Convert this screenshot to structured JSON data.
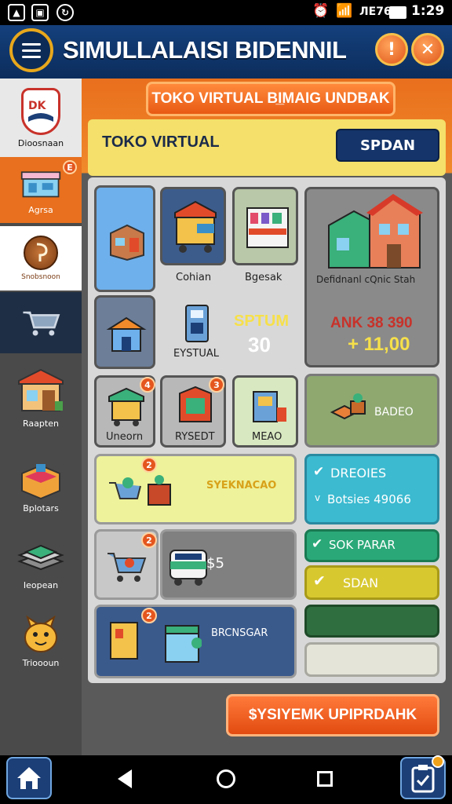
{
  "status_bar": {
    "battery": "ЛЕ76",
    "time": "1:29"
  },
  "header": {
    "title": "SIMULLALAISI BIDENNIL"
  },
  "sidebar": {
    "items": [
      {
        "label": "Dioosnaan",
        "icon": "logo-badge-icon"
      },
      {
        "label": "Agrsa",
        "icon": "shop-icon",
        "badge": "E"
      },
      {
        "label": "Snobsnoon",
        "icon": "coin-icon"
      },
      {
        "label": "",
        "icon": "cart-icon"
      },
      {
        "label": "Raapten",
        "icon": "market-stall-icon"
      },
      {
        "label": "Bplotars",
        "icon": "box-icon"
      },
      {
        "label": "Ieopean",
        "icon": "stack-icon"
      },
      {
        "label": "Trioooun",
        "icon": "mascot-icon"
      }
    ]
  },
  "main": {
    "banner": "TOKO VIRTUAL BI̲MAIG UNDBAK",
    "store_title": "TOKO VIRTUAL",
    "store_button": "SPDAN",
    "tiles": {
      "t1": {
        "label": ""
      },
      "t2": {
        "label": "Cohian"
      },
      "t3": {
        "label": "Bgesak"
      },
      "t4": {
        "label": "Defidnanl cQnic Stah"
      },
      "t5": {
        "label": ""
      },
      "t6": {
        "label": "EYSTUAL"
      },
      "t6_stat_title": "SPTUM",
      "t6_stat_value": "30",
      "t7_stat_title": "ANK 38 390",
      "t7_stat_value": "+ 11,00",
      "t8": {
        "label": "Uneorn",
        "badge": "4"
      },
      "t9": {
        "label": "RYSEDT",
        "badge": "3"
      },
      "t10": {
        "label": "MEAO"
      },
      "t11": {
        "label": "BADEO"
      },
      "t12": {
        "label": "SYEKNACAO",
        "badge": "2"
      },
      "t13": {
        "label": "DREOIES"
      },
      "t13b": {
        "label": "Botsies 49066"
      },
      "t14": {
        "label": "$5",
        "badge": "2"
      },
      "t15": {
        "label": "SOK PARAR"
      },
      "t16": {
        "label": "SDAN"
      },
      "t17": {
        "label": "BRCNSGAR",
        "badge": "2"
      }
    }
  },
  "cta": {
    "label": "$YSIYEMK UPIPRDAHK"
  },
  "colors": {
    "accent": "#e96f1d",
    "navy": "#14407c",
    "green": "#2f6e3e",
    "teal": "#3bbad0",
    "yellow": "#e8d840"
  }
}
